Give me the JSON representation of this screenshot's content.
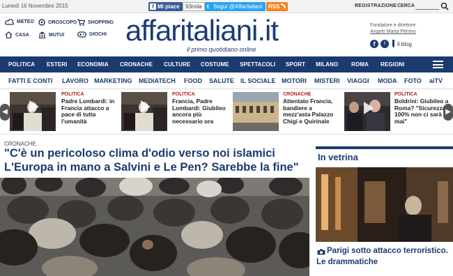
{
  "topbar": {
    "date": "Lunedì 16 Novembre 2015",
    "fb_like": "Mi piace",
    "fb_count": "93mila",
    "twitter": "Segui @Affaritaliani",
    "rss": "RSS",
    "register": "REGISTRAZIONE",
    "search": "CERCA"
  },
  "services": [
    {
      "label": "METEO",
      "icon": "weather-icon"
    },
    {
      "label": "OROSCOPO",
      "icon": "horoscope-icon"
    },
    {
      "label": "SHOPPING",
      "icon": "cart-icon"
    },
    {
      "label": "CASA",
      "icon": "house-icon"
    },
    {
      "label": "MUTUI",
      "icon": "bank-icon"
    },
    {
      "label": "GIOCHI",
      "icon": "gamepad-icon"
    }
  ],
  "logo": "affaritaliani.it",
  "tagline": "il primo quotidiano online",
  "founder": {
    "label": "Fondatore e direttore",
    "name": "Angelo Maria Perrino",
    "blog": "il blog"
  },
  "nav_primary": [
    "POLITICA",
    "ESTERI",
    "ECONOMIA",
    "CRONACHE",
    "CULTURE",
    "COSTUME",
    "SPETTACOLI",
    "SPORT",
    "MILANO",
    "ROMA",
    "REGIONI"
  ],
  "nav_secondary": [
    "FATTI E CONTI",
    "LAVORO",
    "MARKETING",
    "MEDIATECH",
    "FOOD",
    "SALUTE",
    "IL SOCIALE",
    "MOTORI",
    "MISTERI",
    "VIAGGI",
    "MODA",
    "FOTO",
    "aiTV"
  ],
  "carousel": [
    {
      "category": "POLITICA",
      "title": "Padre Lombardi: in Francia attacco a pace di tutta l'umanità"
    },
    {
      "category": "POLITICA",
      "title": "Francia, Padre Lombardi: Giubileo ancora più necessario ora"
    },
    {
      "category": "CRONACHE",
      "title": "Attentato Francia, bandiere a mezz'asta Palazzo Chigi e Quirinale"
    },
    {
      "category": "POLITICA",
      "title": "Boldrini: Giubileo a Roma? \"Sicurezza 100% non ci sarà mai\""
    }
  ],
  "main": {
    "kicker": "CRONACHE",
    "headline": "\"C'è un pericoloso clima d'odio verso noi islamici L'Europa in mano a Salvini e Le Pen? Sarebbe la fine\""
  },
  "vetrina": {
    "title": "In vetrina",
    "caption": "Parigi sotto attacco terroristico. Le drammatiche"
  },
  "colors": {
    "navy": "#1b3a6f",
    "category_red": "#b11b1b"
  }
}
